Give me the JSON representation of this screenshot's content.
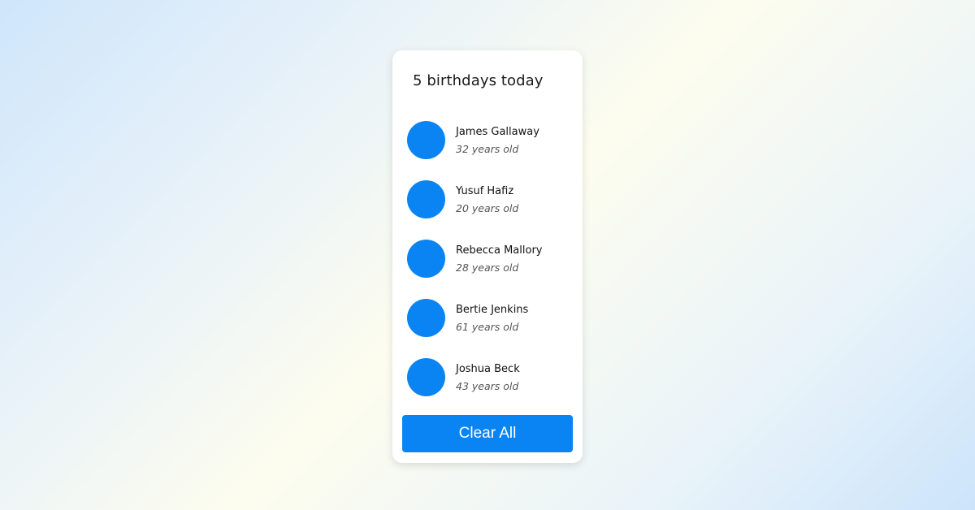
{
  "card": {
    "title": "5 birthdays today",
    "people": [
      {
        "name": "James Gallaway",
        "age": "32 years old"
      },
      {
        "name": "Yusuf Hafiz",
        "age": "20 years old"
      },
      {
        "name": "Rebecca Mallory",
        "age": "28 years old"
      },
      {
        "name": "Bertie Jenkins",
        "age": "61 years old"
      },
      {
        "name": "Joshua Beck",
        "age": "43 years old"
      }
    ],
    "clear_label": "Clear All"
  },
  "colors": {
    "accent": "#0a84f2",
    "card_background": "#ffffff"
  }
}
